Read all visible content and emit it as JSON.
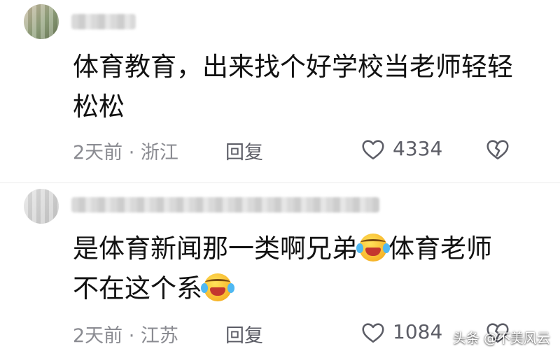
{
  "comments": [
    {
      "text_line1": "体育教育，出来找个好学校当老师轻轻",
      "text_line2": "松松",
      "meta": "2天前 · 浙江",
      "reply_label": "回复",
      "like_count": "4334"
    },
    {
      "text_line1_a": "是体育新闻那一类啊兄弟",
      "text_line1_b": "体育老师",
      "text_line2": "不在这个系",
      "meta": "2天前 · 江苏",
      "reply_label": "回复",
      "like_count": "1084"
    }
  ],
  "icons": {
    "like": "heart-outline-icon",
    "dislike": "broken-heart-icon",
    "emoji": "laughing-crying-emoji"
  },
  "watermark": "头条 @不美风云",
  "colors": {
    "text": "#111111",
    "meta": "#8a8b91",
    "action": "#5c5d66"
  }
}
